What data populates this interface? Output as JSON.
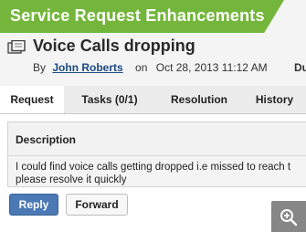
{
  "banner": {
    "title": "Service Request Enhancements"
  },
  "ticket": {
    "title": "Voice Calls dropping",
    "by_label": "By",
    "author": "John Roberts",
    "on_label": "on",
    "datetime": "Oct 28, 2013 11:12 AM",
    "cut_label": "Du"
  },
  "tabs": [
    {
      "label": "Request",
      "active": true
    },
    {
      "label": "Tasks (0/1)",
      "active": false
    },
    {
      "label": "Resolution",
      "active": false
    },
    {
      "label": "History",
      "active": false
    }
  ],
  "description": {
    "label": "Description",
    "lines": [
      "I could find voice calls getting dropped i.e missed to reach t",
      "please resolve it quickly"
    ]
  },
  "actions": {
    "reply_label": "Reply",
    "forward_label": "Forward"
  },
  "icons": {
    "ticket": "ticket-icon",
    "zoom": "zoom-in-icon"
  },
  "colors": {
    "banner": "#74b63b",
    "reply_button": "#4b79b5",
    "link": "#1a4a80"
  }
}
